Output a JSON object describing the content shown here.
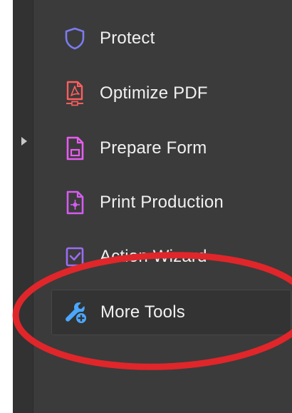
{
  "sidebar": {
    "items": [
      {
        "label": "Protect",
        "icon": "shield-icon",
        "color": "#7b7bf0"
      },
      {
        "label": "Optimize PDF",
        "icon": "optimize-pdf-icon",
        "color": "#ff5e5e"
      },
      {
        "label": "Prepare Form",
        "icon": "prepare-form-icon",
        "color": "#e85cf2"
      },
      {
        "label": "Print Production",
        "icon": "print-production-icon",
        "color": "#d45cf0"
      },
      {
        "label": "Action Wizard",
        "icon": "action-wizard-icon",
        "color": "#9b6cf2"
      },
      {
        "label": "More Tools",
        "icon": "more-tools-icon",
        "color": "#4aa8ff"
      }
    ]
  },
  "colors": {
    "panel_background": "#3b3b3b",
    "annotation_red": "#e0262a"
  }
}
